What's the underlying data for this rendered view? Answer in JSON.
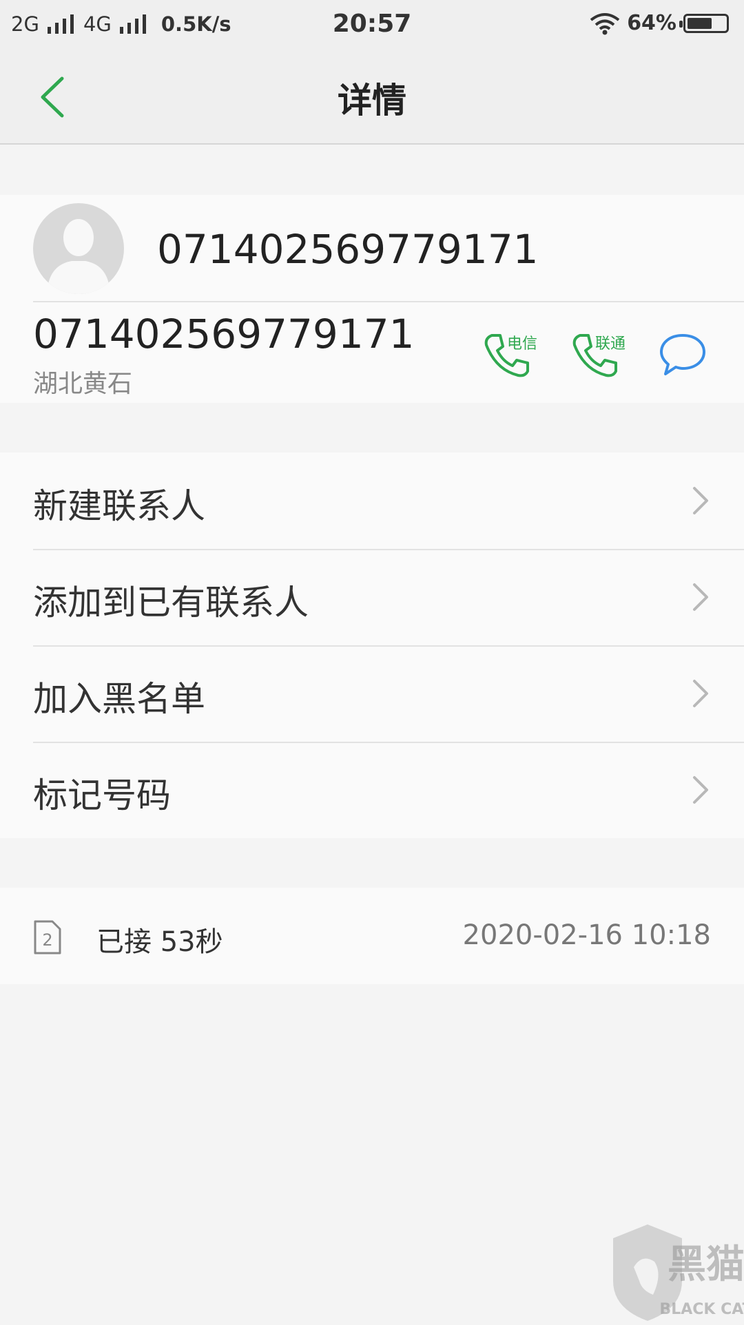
{
  "status_bar": {
    "sim1": "2G",
    "sim2": "4G",
    "speed": "0.5K/s",
    "time": "20:57",
    "battery": "64%",
    "battery_level": 0.64
  },
  "header": {
    "title": "详情"
  },
  "contact": {
    "name": "071402569779171",
    "number": "071402569779171",
    "location": "湖北黄石",
    "call_options": [
      {
        "label": "电信"
      },
      {
        "label": "联通"
      }
    ]
  },
  "menu": [
    {
      "label": "新建联系人"
    },
    {
      "label": "添加到已有联系人"
    },
    {
      "label": "加入黑名单"
    },
    {
      "label": "标记号码"
    }
  ],
  "call_log": {
    "sim_slot": "2",
    "status": "已接 53秒",
    "datetime": "2020-02-16 10:18"
  },
  "watermark": {
    "text": "黑猫",
    "subtext": "BLACK CAT"
  },
  "colors": {
    "accent_green": "#2fa84f",
    "accent_blue": "#3a8ee6",
    "background": "#f4f4f4"
  }
}
